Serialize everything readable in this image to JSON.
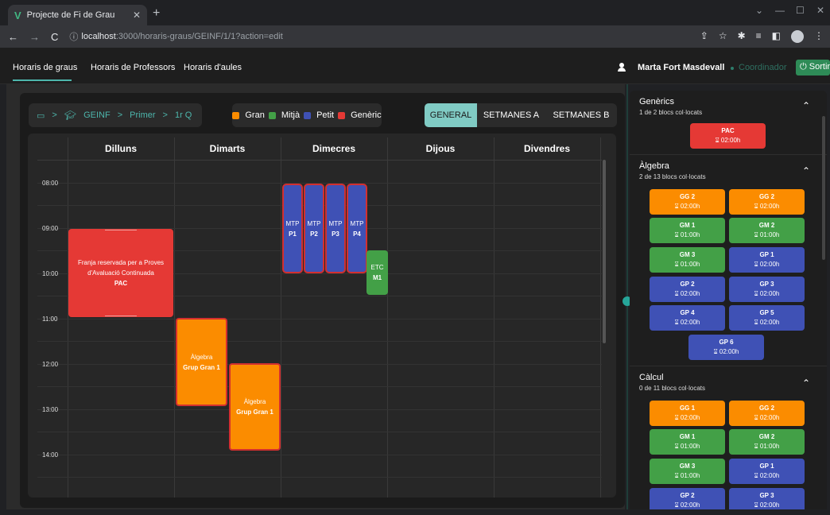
{
  "browser": {
    "tab_title": "Projecte de Fi de Grau",
    "tab_logo": "V",
    "url_host": "localhost",
    "url_rest": ":3000/horaris-graus/GEINF/1/1?action=edit"
  },
  "header": {
    "tabs": [
      "Horaris de graus",
      "Horaris de Professors",
      "Horaris d'aules"
    ],
    "user_name": "Marta Fort Masdevall",
    "role": "Coordinador",
    "logout_label": "Sortir"
  },
  "breadcrumb": {
    "items": [
      "GEINF",
      "Primer",
      "1r Q"
    ],
    "separator": ">"
  },
  "legend": [
    {
      "label": "Gran",
      "color": "#fb8c00"
    },
    {
      "label": "Mitjà",
      "color": "#43a047"
    },
    {
      "label": "Petit",
      "color": "#3f51b5"
    },
    {
      "label": "Genèric",
      "color": "#e53935"
    }
  ],
  "view_tabs": {
    "active": "GENERAL",
    "items": [
      "GENERAL",
      "SETMANES A",
      "SETMANES B"
    ]
  },
  "calendar": {
    "days": [
      "Dilluns",
      "Dimarts",
      "Dimecres",
      "Dijous",
      "Divendres"
    ],
    "times": [
      "08:00",
      "09:00",
      "10:00",
      "11:00",
      "12:00",
      "13:00",
      "14:00"
    ]
  },
  "events": {
    "pac": {
      "line1": "Franja reservada per a Proves",
      "line2": "d'Avaluació Continuada",
      "bold": "PAC"
    },
    "alg1": {
      "line1": "Àlgebra",
      "bold": "Grup Gran 1"
    },
    "alg2": {
      "line1": "Àlgebra",
      "bold": "Grup Gran 1"
    },
    "mtp": [
      {
        "line1": "MTP",
        "bold": "P1"
      },
      {
        "line1": "MTP",
        "bold": "P2"
      },
      {
        "line1": "MTP",
        "bold": "P3"
      },
      {
        "line1": "MTP",
        "bold": "P4"
      }
    ],
    "etc": {
      "line1": "ETC",
      "bold": "M1"
    }
  },
  "sidebar": {
    "genercs": {
      "title": "Genèrics",
      "subtitle": "1 de 2 blocs col·locats",
      "blocks": [
        {
          "label": "PAC",
          "duration": "02:00h"
        }
      ]
    },
    "algebra": {
      "title": "Àlgebra",
      "subtitle": "2 de 13 blocs col·locats",
      "blocks": [
        {
          "label": "GG 2",
          "duration": "02:00h"
        },
        {
          "label": "GG 2",
          "duration": "02:00h"
        },
        {
          "label": "GM 1",
          "duration": "01:00h"
        },
        {
          "label": "GM 2",
          "duration": "01:00h"
        },
        {
          "label": "GM 3",
          "duration": "01:00h"
        },
        {
          "label": "GP 1",
          "duration": "02:00h"
        },
        {
          "label": "GP 2",
          "duration": "02:00h"
        },
        {
          "label": "GP 3",
          "duration": "02:00h"
        },
        {
          "label": "GP 4",
          "duration": "02:00h"
        },
        {
          "label": "GP 5",
          "duration": "02:00h"
        },
        {
          "label": "GP 6",
          "duration": "02:00h"
        }
      ]
    },
    "calcul": {
      "title": "Càlcul",
      "subtitle": "0 de 11 blocs col·locats",
      "blocks": [
        {
          "label": "GG 1",
          "duration": "02:00h"
        },
        {
          "label": "GG 2",
          "duration": "02:00h"
        },
        {
          "label": "GM 1",
          "duration": "01:00h"
        },
        {
          "label": "GM 2",
          "duration": "01:00h"
        },
        {
          "label": "GM 3",
          "duration": "01:00h"
        },
        {
          "label": "GP 1",
          "duration": "02:00h"
        },
        {
          "label": "GP 2",
          "duration": "02:00h"
        },
        {
          "label": "GP 3",
          "duration": "02:00h"
        }
      ]
    }
  }
}
